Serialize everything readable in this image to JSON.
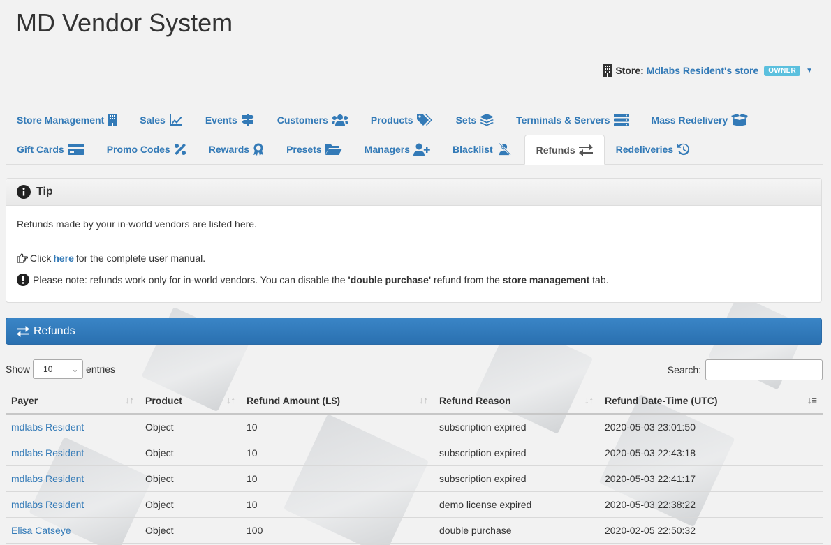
{
  "app": {
    "title": "MD Vendor System"
  },
  "store": {
    "label": "Store:",
    "name": "Mdlabs Resident's store",
    "badge": "OWNER"
  },
  "tabs_row1": [
    {
      "label": "Store Management",
      "icon": "building-icon"
    },
    {
      "label": "Sales",
      "icon": "chart-line-icon"
    },
    {
      "label": "Events",
      "icon": "signs-icon"
    },
    {
      "label": "Customers",
      "icon": "users-icon"
    },
    {
      "label": "Products",
      "icon": "tags-icon"
    },
    {
      "label": "Sets",
      "icon": "layers-icon"
    },
    {
      "label": "Terminals & Servers",
      "icon": "server-icon"
    },
    {
      "label": "Mass Redelivery",
      "icon": "box-open-icon"
    }
  ],
  "tabs_row2": [
    {
      "label": "Gift Cards",
      "icon": "credit-card-icon"
    },
    {
      "label": "Promo Codes",
      "icon": "percent-icon"
    },
    {
      "label": "Rewards",
      "icon": "award-icon"
    },
    {
      "label": "Presets",
      "icon": "folder-open-icon"
    },
    {
      "label": "Managers",
      "icon": "user-plus-icon"
    },
    {
      "label": "Blacklist",
      "icon": "user-slash-icon"
    },
    {
      "label": "Refunds",
      "icon": "exchange-icon",
      "active": true
    },
    {
      "label": "Redeliveries",
      "icon": "history-icon"
    }
  ],
  "tip": {
    "title": "Tip",
    "line1": "Refunds made by your in-world vendors are listed here.",
    "click": "Click",
    "here": "here",
    "manual": "for the complete user manual.",
    "note_a": "Please note: refunds work only for in-world vendors. You can disable the",
    "note_b": "'double purchase'",
    "note_c": "refund from the",
    "note_d": "store management",
    "note_e": "tab."
  },
  "refunds": {
    "title": "Refunds",
    "show": "Show",
    "entries": "entries",
    "page_size": "10",
    "search_label": "Search:",
    "columns": [
      "Payer",
      "Product",
      "Refund Amount (L$)",
      "Refund Reason",
      "Refund Date-Time (UTC)"
    ],
    "rows": [
      [
        "mdlabs Resident",
        "Object",
        "10",
        "subscription expired",
        "2020-05-03 23:01:50"
      ],
      [
        "mdlabs Resident",
        "Object",
        "10",
        "subscription expired",
        "2020-05-03 22:43:18"
      ],
      [
        "mdlabs Resident",
        "Object",
        "10",
        "subscription expired",
        "2020-05-03 22:41:17"
      ],
      [
        "mdlabs Resident",
        "Object",
        "10",
        "demo license expired",
        "2020-05-03 22:38:22"
      ],
      [
        "Elisa Catseye",
        "Object",
        "100",
        "double purchase",
        "2020-02-05 22:50:32"
      ]
    ]
  }
}
